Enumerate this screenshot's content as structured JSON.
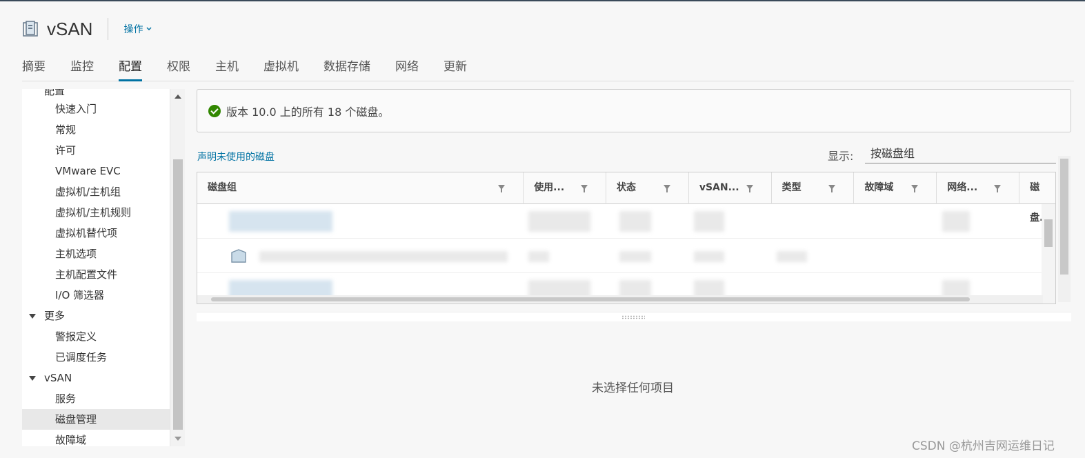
{
  "header": {
    "title": "vSAN",
    "actions_label": "操作"
  },
  "tabs": [
    {
      "label": "摘要"
    },
    {
      "label": "监控"
    },
    {
      "label": "配置",
      "active": true
    },
    {
      "label": "权限"
    },
    {
      "label": "主机"
    },
    {
      "label": "虚拟机"
    },
    {
      "label": "数据存储"
    },
    {
      "label": "网络"
    },
    {
      "label": "更新"
    }
  ],
  "sidebar": {
    "partial_group": "配置",
    "config_items": [
      "快速入门",
      "常规",
      "许可",
      "VMware EVC",
      "虚拟机/主机组",
      "虚拟机/主机规则",
      "虚拟机替代项",
      "主机选项",
      "主机配置文件",
      "I/O 筛选器"
    ],
    "more_group": "更多",
    "more_items": [
      "警报定义",
      "已调度任务"
    ],
    "vsan_group": "vSAN",
    "vsan_items": [
      "服务",
      "磁盘管理",
      "故障域"
    ],
    "selected": "磁盘管理"
  },
  "status": {
    "message": "版本 10.0 上的所有 18 个磁盘。"
  },
  "toolbar": {
    "claim_link": "声明未使用的磁盘",
    "show_label": "显示:",
    "show_value": "按磁盘组"
  },
  "grid": {
    "columns": [
      "磁盘组",
      "使用...",
      "状态",
      "vSAN...",
      "类型",
      "故障域",
      "网络...",
      "磁盘..."
    ]
  },
  "detail": {
    "empty_text": "未选择任何项目"
  },
  "watermark": "CSDN @杭州吉网运维日记"
}
